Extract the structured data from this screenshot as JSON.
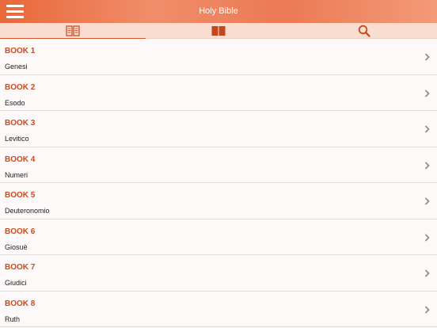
{
  "header": {
    "title": "Holy Bible"
  },
  "tabs": [
    {
      "name": "books-tab",
      "icon": "book-list-icon",
      "active": true
    },
    {
      "name": "reading-tab",
      "icon": "open-book-icon",
      "active": false
    },
    {
      "name": "search-tab",
      "icon": "search-icon",
      "active": false
    }
  ],
  "books": [
    {
      "label": "BOOK 1",
      "name": "Genesi"
    },
    {
      "label": "BOOK 2",
      "name": "Esodo"
    },
    {
      "label": "BOOK 3",
      "name": "Levitico"
    },
    {
      "label": "BOOK 4",
      "name": "Numeri"
    },
    {
      "label": "BOOK 5",
      "name": "Deuteronomio"
    },
    {
      "label": "BOOK 6",
      "name": "Giosuè"
    },
    {
      "label": "BOOK 7",
      "name": "Giudici"
    },
    {
      "label": "BOOK 8",
      "name": "Ruth"
    }
  ],
  "colors": {
    "accent": "#cc4a1e",
    "header": "#ec7a55",
    "tabbar": "#f9ddd0"
  }
}
